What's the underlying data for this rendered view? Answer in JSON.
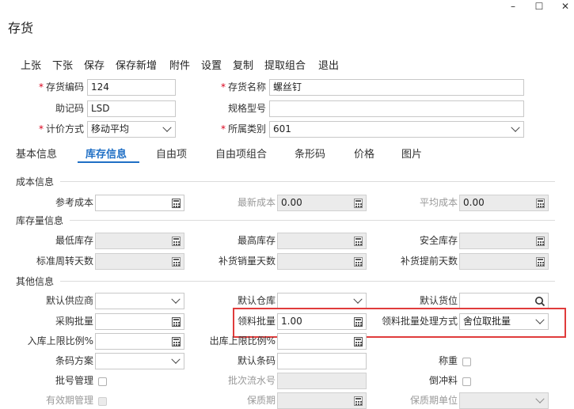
{
  "window": {
    "title": "存货",
    "controls": {
      "minimize": "–",
      "maximize": "☐",
      "close": "✕"
    }
  },
  "toolbar": [
    "上张",
    "下张",
    "保存",
    "保存新增",
    "附件",
    "设置",
    "复制",
    "提取组合",
    "退出"
  ],
  "header": {
    "code": {
      "label": "存货编码",
      "value": "124"
    },
    "name": {
      "label": "存货名称",
      "value": "螺丝钉"
    },
    "mnemonic": {
      "label": "助记码",
      "value": "LSD"
    },
    "spec": {
      "label": "规格型号",
      "value": ""
    },
    "pricing": {
      "label": "计价方式",
      "value": "移动平均"
    },
    "category": {
      "label": "所属类别",
      "value": "601"
    }
  },
  "tabs": [
    "基本信息",
    "库存信息",
    "自由项",
    "自由项组合",
    "条形码",
    "价格",
    "图片"
  ],
  "active_tab": "库存信息",
  "sections": {
    "cost": {
      "title": "成本信息",
      "ref_cost": {
        "label": "参考成本",
        "value": ""
      },
      "latest_cost": {
        "label": "最新成本",
        "value": "0.00"
      },
      "avg_cost": {
        "label": "平均成本",
        "value": "0.00"
      }
    },
    "stock": {
      "title": "库存量信息",
      "min_stock": {
        "label": "最低库存",
        "value": ""
      },
      "max_stock": {
        "label": "最高库存",
        "value": ""
      },
      "safety_stock": {
        "label": "安全库存",
        "value": ""
      },
      "turnover_days": {
        "label": "标准周转天数",
        "value": ""
      },
      "replenish_sales_days": {
        "label": "补货销量天数",
        "value": ""
      },
      "replenish_lead_days": {
        "label": "补货提前天数",
        "value": ""
      }
    },
    "other": {
      "title": "其他信息",
      "default_supplier": {
        "label": "默认供应商",
        "value": ""
      },
      "default_warehouse": {
        "label": "默认仓库",
        "value": ""
      },
      "default_location": {
        "label": "默认货位",
        "value": ""
      },
      "purchase_batch": {
        "label": "采购批量",
        "value": ""
      },
      "pick_batch": {
        "label": "领料批量",
        "value": "1.00"
      },
      "pick_batch_mode": {
        "label": "领料批量处理方式",
        "value": "舍位取批量"
      },
      "in_limit_ratio": {
        "label": "入库上限比例%",
        "value": ""
      },
      "out_limit_ratio": {
        "label": "出库上限比例%",
        "value": ""
      },
      "barcode_scheme": {
        "label": "条码方案",
        "value": ""
      },
      "default_barcode": {
        "label": "默认条码",
        "value": ""
      },
      "weighing": {
        "label": "称重"
      },
      "batch_mgmt": {
        "label": "批号管理"
      },
      "batch_serial": {
        "label": "批次流水号",
        "value": ""
      },
      "backflush": {
        "label": "倒冲料"
      },
      "expiry_mgmt": {
        "label": "有效期管理"
      },
      "shelf_life": {
        "label": "保质期",
        "value": ""
      },
      "shelf_life_unit": {
        "label": "保质期单位",
        "value": ""
      }
    }
  }
}
